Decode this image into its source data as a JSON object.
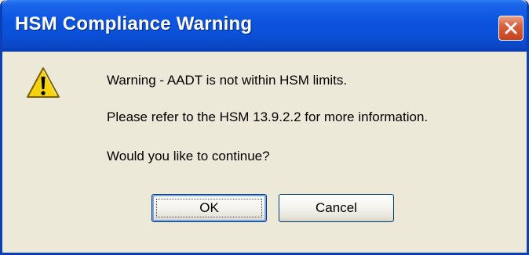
{
  "window": {
    "title": "HSM Compliance Warning"
  },
  "icons": {
    "warning": "warning-icon",
    "close": "close-icon"
  },
  "message": {
    "line1": "Warning - AADT is not within HSM limits.",
    "line2": "Please refer to the HSM 13.9.2.2 for more information.",
    "line3": "Would you like to continue?"
  },
  "buttons": {
    "ok_label": "OK",
    "cancel_label": "Cancel"
  },
  "colors": {
    "titlebar": "#0a4fd6",
    "dialog_bg": "#ece9d8",
    "close_button": "#d9603e",
    "warning_yellow": "#f5d40e"
  }
}
